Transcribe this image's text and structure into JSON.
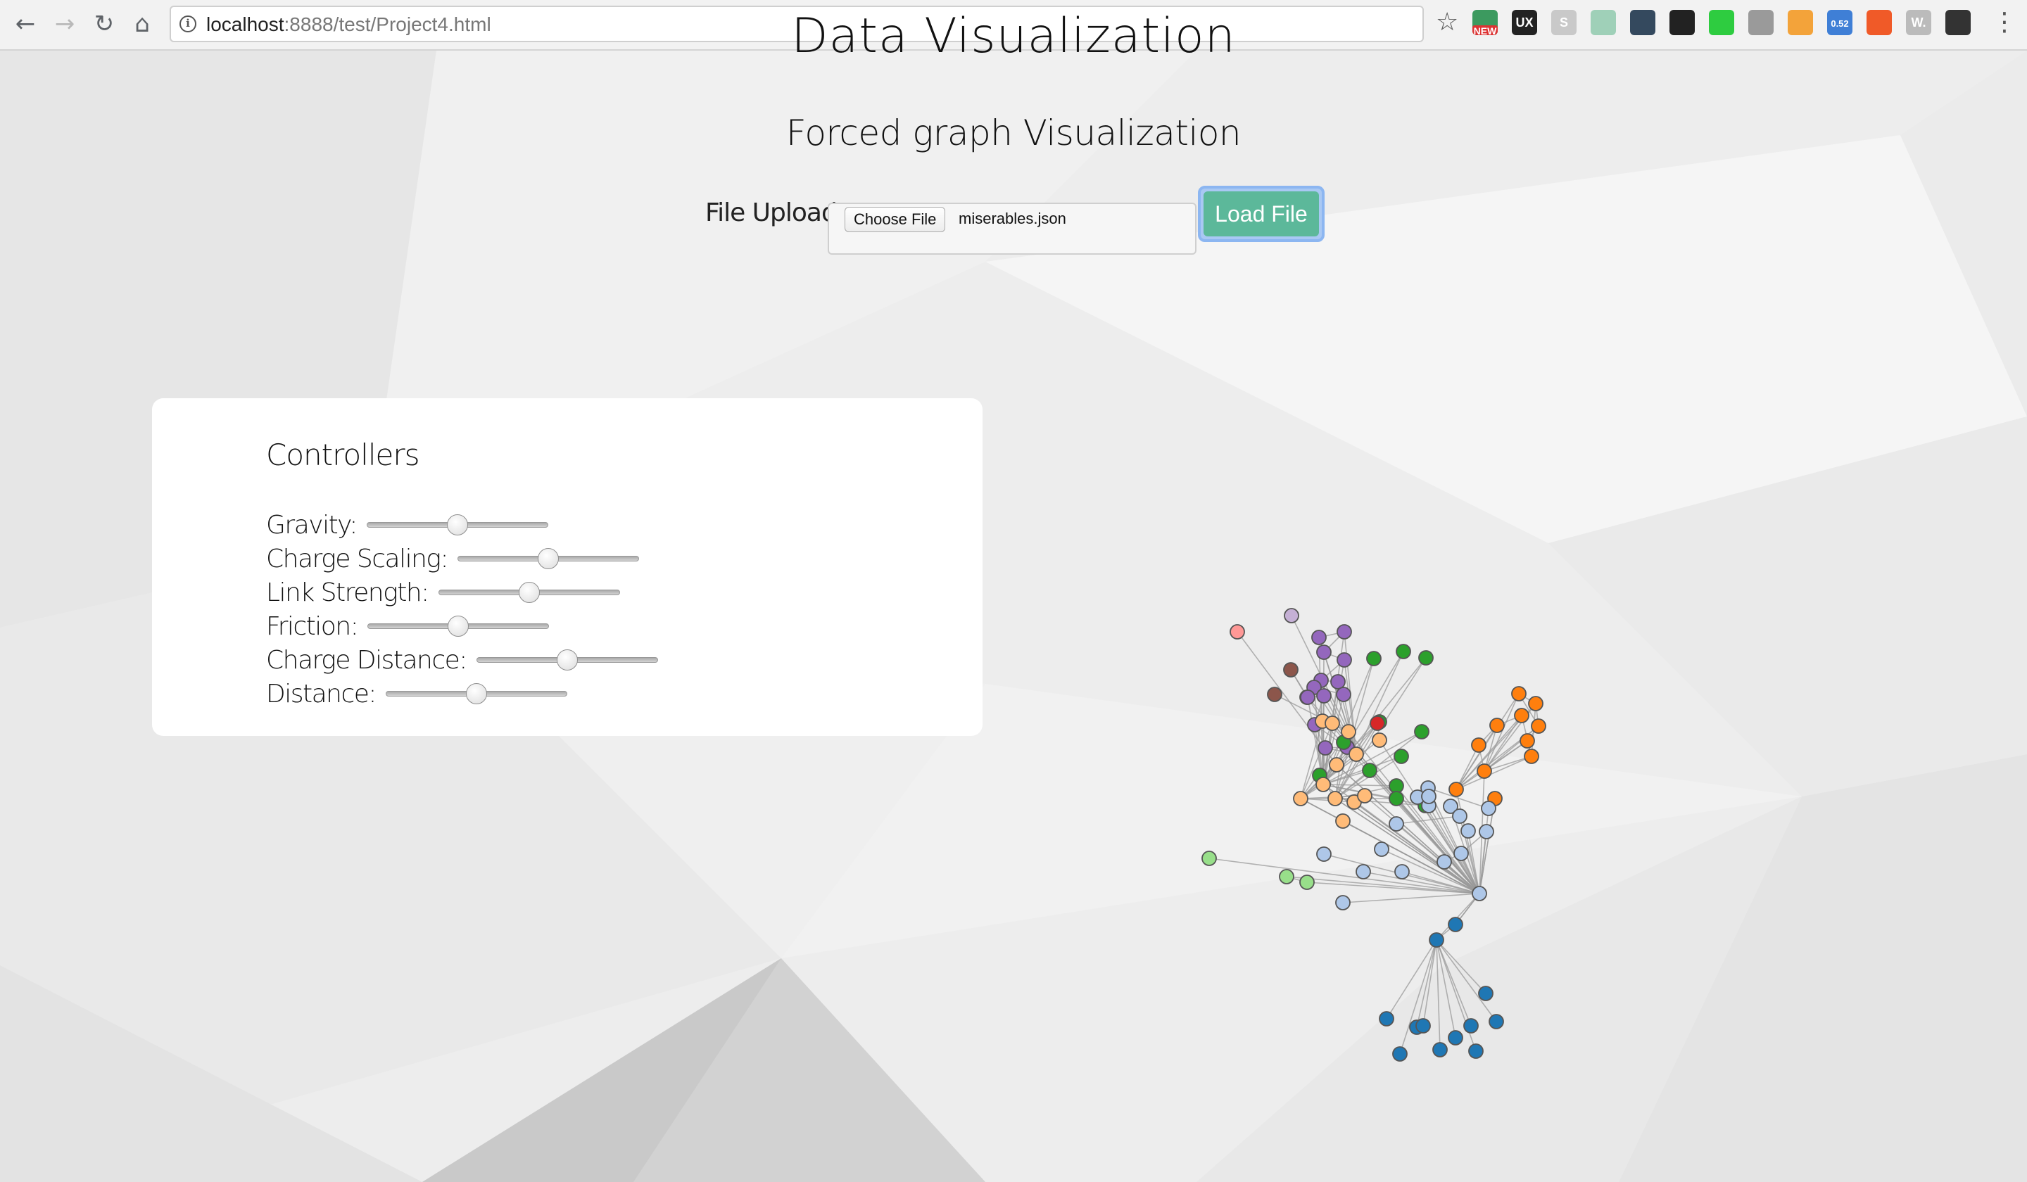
{
  "browser": {
    "url_host": "localhost",
    "url_rest": ":8888/test/Project4.html",
    "extensions": [
      {
        "icon": "new-badge-extension-icon",
        "color": "#3c9a5f",
        "label": "",
        "badge": "NEW"
      },
      {
        "icon": "ux-check-extension-icon",
        "color": "#222222",
        "label": "UX",
        "badge": ""
      },
      {
        "icon": "skype-extension-icon",
        "color": "#c9c9c9",
        "label": "S",
        "badge": ""
      },
      {
        "icon": "book-extension-icon",
        "color": "#9fd0b8",
        "label": "",
        "badge": ""
      },
      {
        "icon": "eyedropper-extension-icon",
        "color": "#34495e",
        "label": "",
        "badge": ""
      },
      {
        "icon": "crop-extension-icon",
        "color": "#222222",
        "label": "",
        "badge": ""
      },
      {
        "icon": "chat-extension-icon",
        "color": "#2ecc40",
        "label": "",
        "badge": ""
      },
      {
        "icon": "camera-extension-icon",
        "color": "#9a9a9a",
        "label": "",
        "badge": ""
      },
      {
        "icon": "image-extension-icon",
        "color": "#f3a33a",
        "label": "",
        "badge": ""
      },
      {
        "icon": "speed-extension-icon",
        "color": "#3f7fd6",
        "label": "0.52",
        "badge": ""
      },
      {
        "icon": "kiwi-extension-icon",
        "color": "#f05a28",
        "label": "",
        "badge": ""
      },
      {
        "icon": "w-extension-icon",
        "color": "#bbbbbb",
        "label": "W.",
        "badge": ""
      },
      {
        "icon": "download-extension-icon",
        "color": "#333333",
        "label": "",
        "badge": ""
      }
    ]
  },
  "page": {
    "heading": "Data Visualization",
    "subheading": "Forced graph Visualization",
    "upload": {
      "label": "File Upload:",
      "choose_button": "Choose File",
      "file_name": "miserables.json",
      "load_button": "Load File"
    },
    "controllers": {
      "title": "Controllers",
      "sliders": [
        {
          "label": "Gravity:",
          "value": 0.5
        },
        {
          "label": "Charge Scaling:",
          "value": 0.5
        },
        {
          "label": "Link Strength:",
          "value": 0.5
        },
        {
          "label": "Friction:",
          "value": 0.5
        },
        {
          "label": "Charge Distance:",
          "value": 0.5
        },
        {
          "label": "Distance:",
          "value": 0.5
        }
      ]
    }
  },
  "graph": {
    "group_colors": [
      "#1f77b4",
      "#aec7e8",
      "#ff7f0e",
      "#ffbb78",
      "#2ca02c",
      "#98df8a",
      "#d62728",
      "#ff9896",
      "#9467bd",
      "#c5b0d5",
      "#8c564b"
    ]
  }
}
